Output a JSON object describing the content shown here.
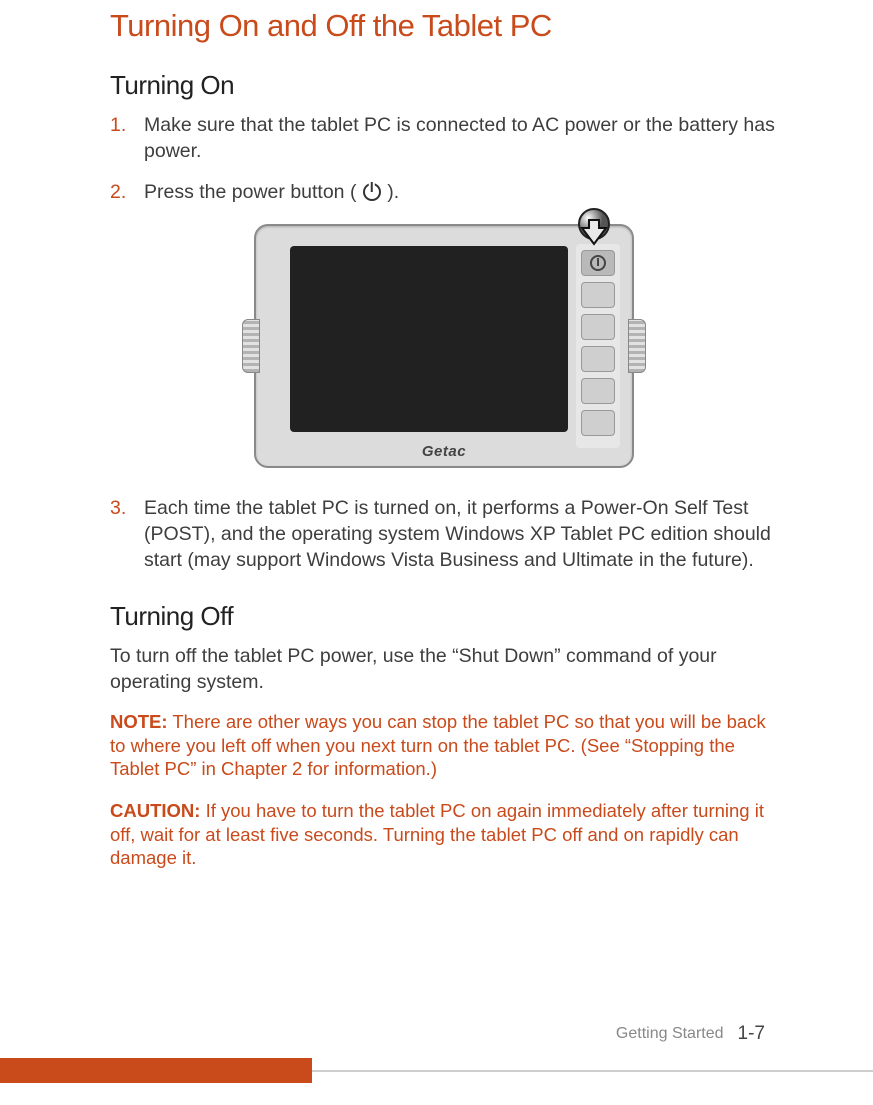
{
  "title": "Turning On and Off the Tablet PC",
  "sections": {
    "on": {
      "heading": "Turning On",
      "steps": [
        "Make sure that the tablet PC is connected to AC power or the battery has power.",
        "Press the power button (   ).",
        "Each time the tablet PC is turned on, it performs a Power-On Self Test (POST), and the operating system Windows XP Tablet PC edition should start (may support Windows Vista Business and Ultimate in the future)."
      ]
    },
    "off": {
      "heading": "Turning Off",
      "body": "To turn off the tablet PC power, use the “Shut Down” command of your operating system."
    }
  },
  "device_brand": "Getac",
  "note": {
    "label": "NOTE:",
    "text": "There are other ways you can stop the tablet PC so that you will be back to where you left off when you next turn on the tablet PC. (See “Stopping the Tablet PC” in Chapter 2 for information.)"
  },
  "caution": {
    "label": "CAUTION:",
    "text": "If you have to turn the tablet PC on again immediately after turning it off, wait for at least five seconds. Turning the tablet PC off and on rapidly can damage it."
  },
  "footer": {
    "section": "Getting Started",
    "page": "1-7"
  }
}
